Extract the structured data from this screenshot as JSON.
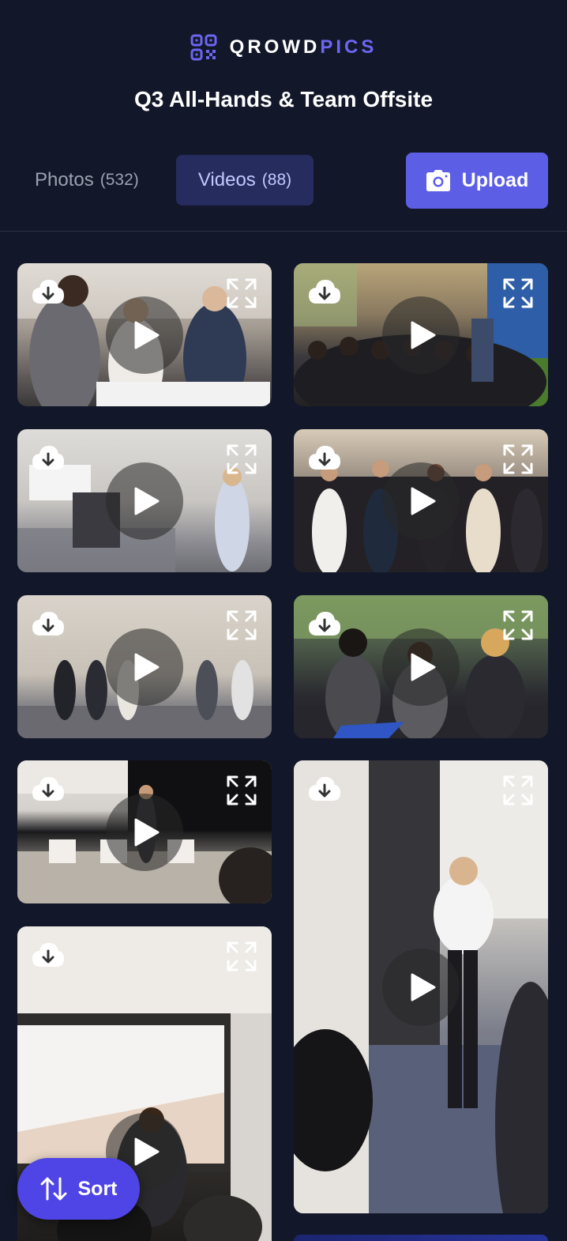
{
  "brand": {
    "name_part1": "QROWD",
    "name_part2": "PICS",
    "logo_icon": "qr-code-icon"
  },
  "event": {
    "title": "Q3 All-Hands & Team Offsite"
  },
  "tabs": [
    {
      "label": "Photos",
      "count": "(532)",
      "active": false
    },
    {
      "label": "Videos",
      "count": "(88)",
      "active": true
    }
  ],
  "upload": {
    "label": "Upload",
    "icon": "camera-icon"
  },
  "sort": {
    "label": "Sort",
    "icon": "sort-arrows-icon"
  },
  "colors": {
    "background": "#121829",
    "accent": "#5d5ee6",
    "active_tab_bg": "#272c5e",
    "active_tab_text": "#c3c7ff",
    "inactive_tab_text": "#9aa1b1"
  },
  "videos": [
    {
      "scene": "networking-coffee-break"
    },
    {
      "scene": "audience-presentation-atrium"
    },
    {
      "scene": "empty-conference-room"
    },
    {
      "scene": "group-standing-crowd"
    },
    {
      "scene": "welcome-wall-room"
    },
    {
      "scene": "meeting-table-discussion"
    },
    {
      "scene": "speaker-on-stage"
    },
    {
      "scene": "presenter-with-microphone"
    },
    {
      "scene": "business-overview-slide"
    }
  ]
}
